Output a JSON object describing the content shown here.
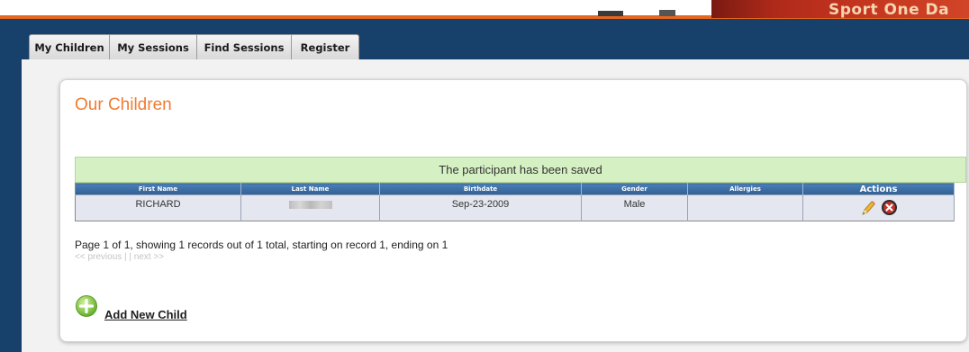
{
  "banner": {
    "brand_text": "Sport One Da"
  },
  "tabs": [
    "My Children",
    "My Sessions",
    "Find Sessions",
    "Register"
  ],
  "page": {
    "title": "Our Children",
    "notice": "The participant has been saved"
  },
  "table": {
    "columns": [
      "First Name",
      "Last Name",
      "Birthdate",
      "Gender",
      "Allergies",
      "Actions"
    ],
    "rows": [
      {
        "first_name": "RICHARD",
        "last_name": "",
        "birthdate": "Sep-23-2009",
        "gender": "Male",
        "allergies": ""
      }
    ]
  },
  "pager": {
    "summary": "Page 1 of 1, showing 1 records out of 1 total, starting on record 1, ending on 1",
    "links": "<< previous | | next >>"
  },
  "actions": {
    "add_child": "Add New Child"
  },
  "colors": {
    "accent": "#f07c32",
    "navy": "#17406b",
    "notice_bg": "#d5f0c2",
    "header_blue": "#2f5f95"
  },
  "icons": {
    "edit": "pencil-icon",
    "delete": "delete-icon",
    "add": "plus-circle-icon"
  }
}
